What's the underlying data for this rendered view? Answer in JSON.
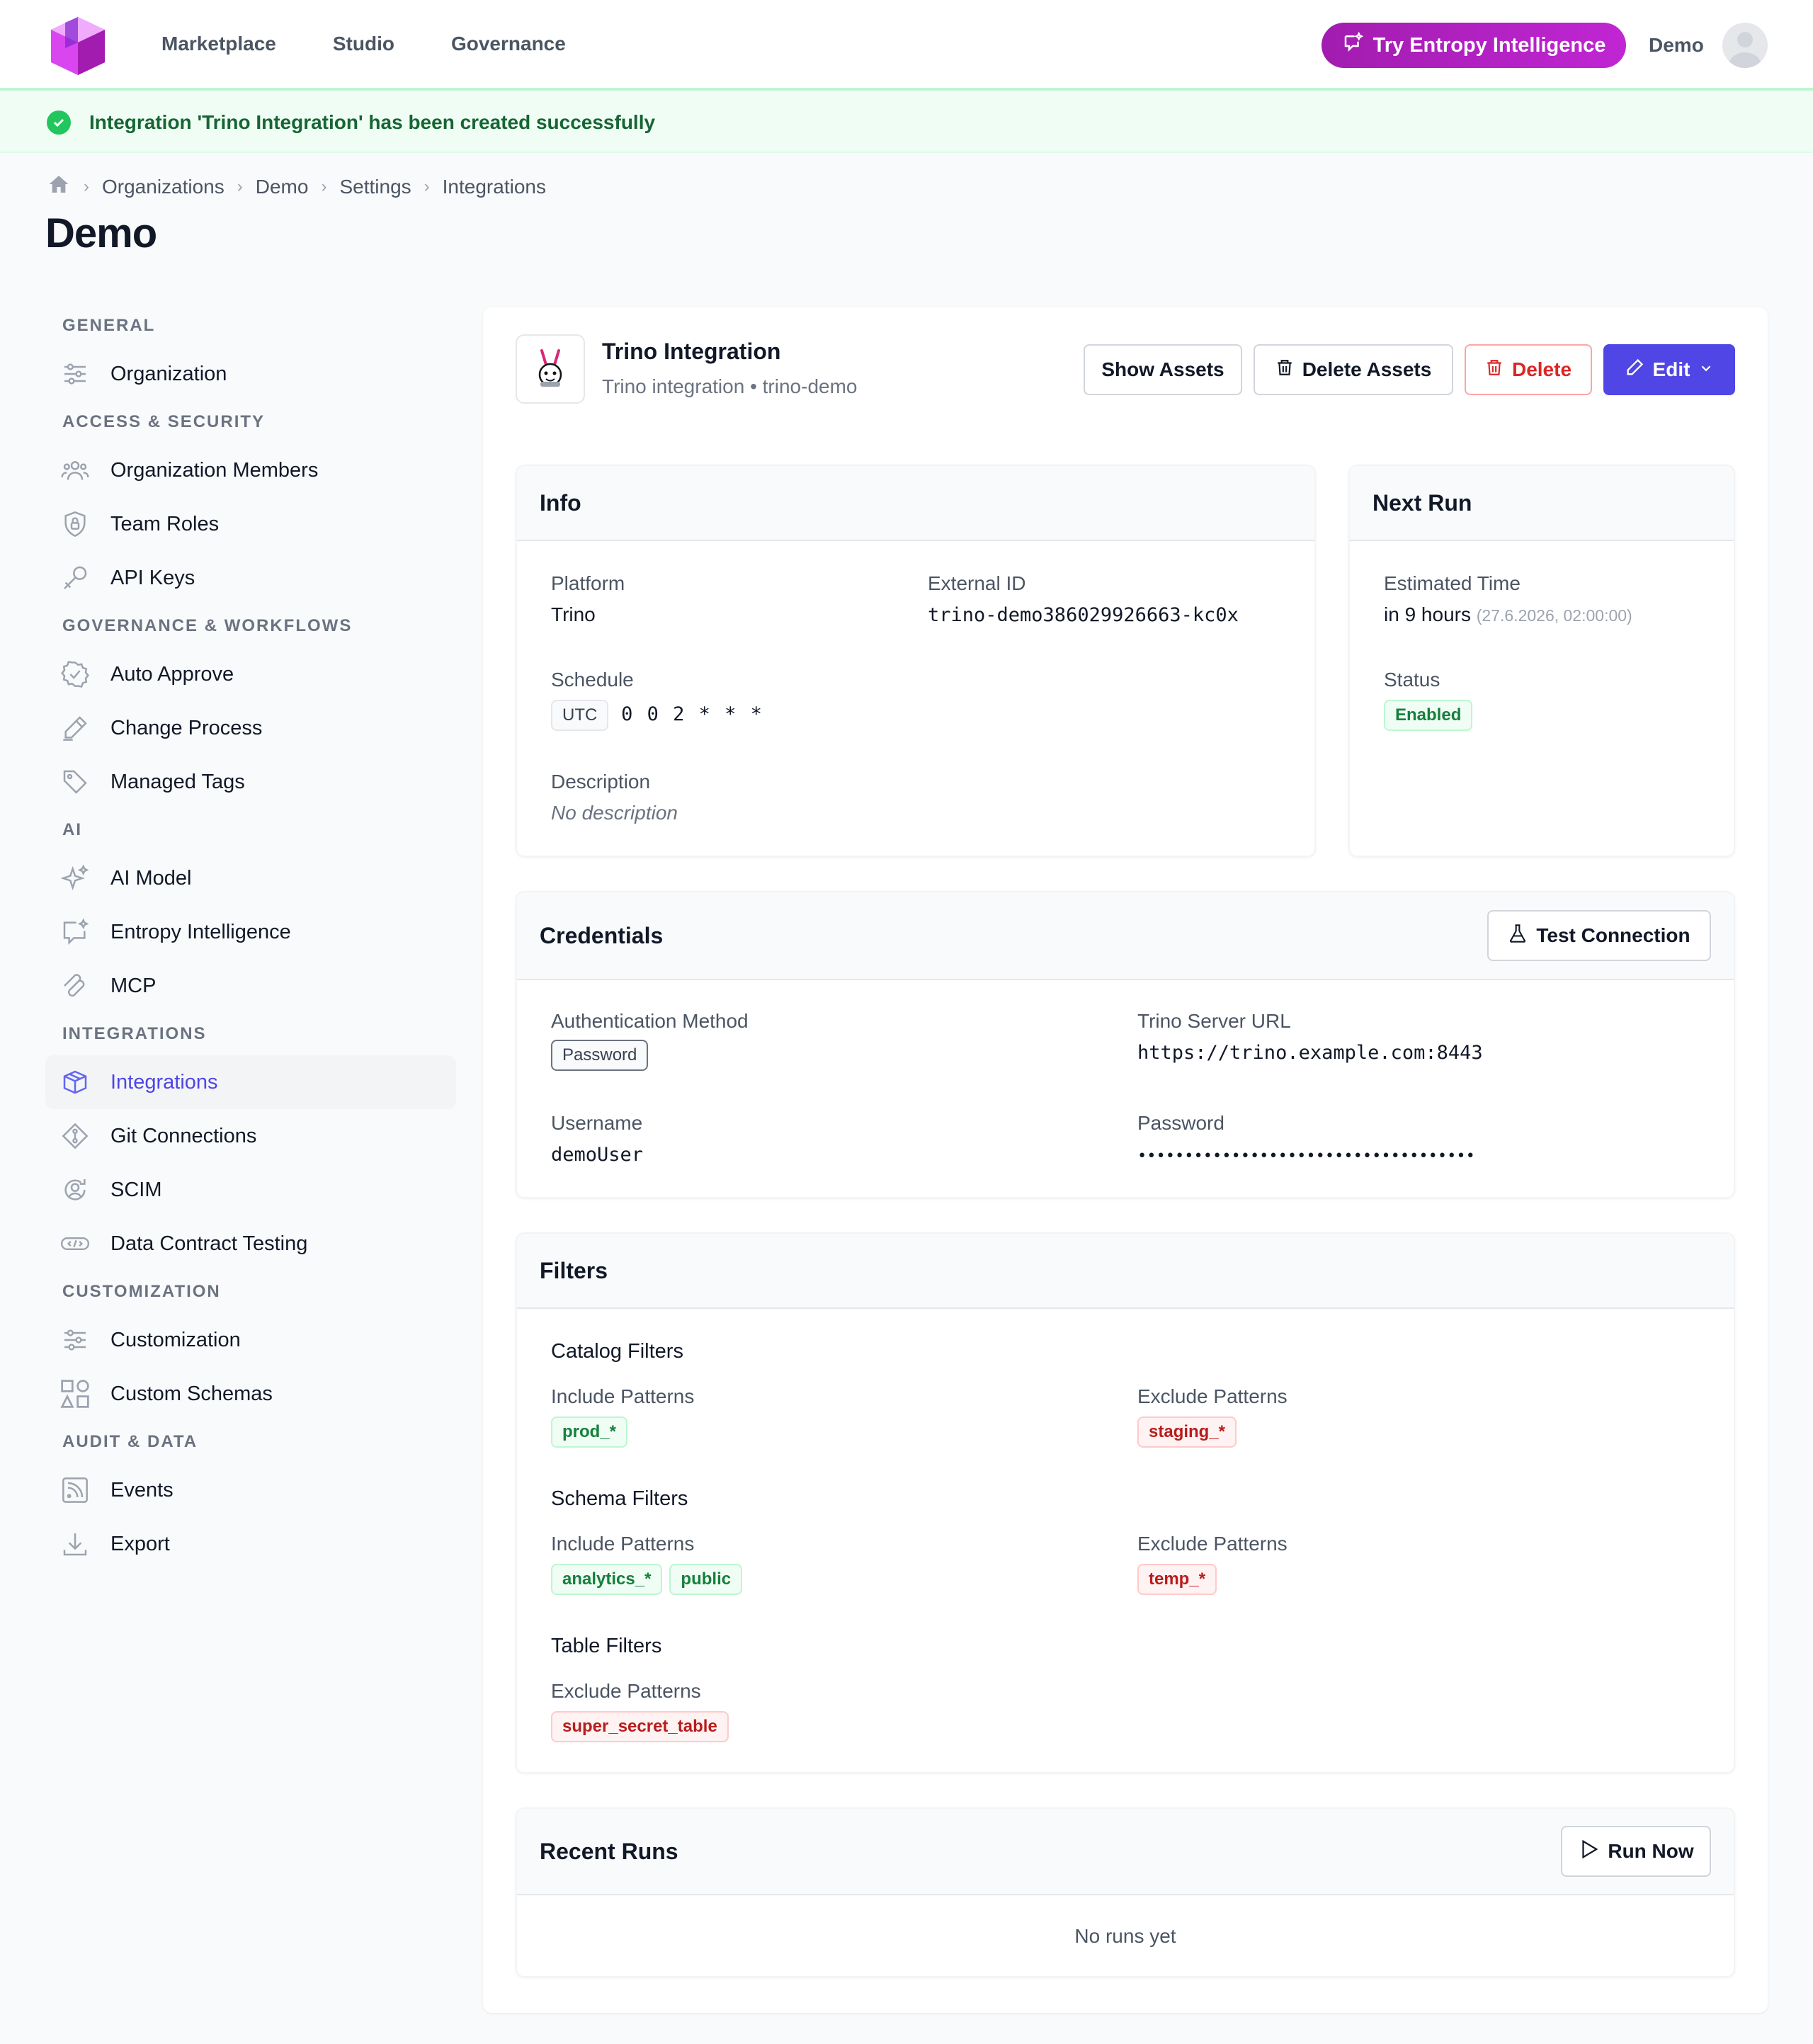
{
  "nav": {
    "items": [
      "Marketplace",
      "Studio",
      "Governance"
    ],
    "try_button": "Try Entropy Intelligence",
    "user": "Demo"
  },
  "banner": {
    "message": "Integration 'Trino Integration' has been created successfully"
  },
  "breadcrumb": [
    "Organizations",
    "Demo",
    "Settings",
    "Integrations"
  ],
  "page_title": "Demo",
  "sidebar": {
    "sections": [
      {
        "title": "GENERAL",
        "items": [
          "Organization"
        ]
      },
      {
        "title": "ACCESS & SECURITY",
        "items": [
          "Organization Members",
          "Team Roles",
          "API Keys"
        ]
      },
      {
        "title": "GOVERNANCE & WORKFLOWS",
        "items": [
          "Auto Approve",
          "Change Process",
          "Managed Tags"
        ]
      },
      {
        "title": "AI",
        "items": [
          "AI Model",
          "Entropy Intelligence",
          "MCP"
        ]
      },
      {
        "title": "INTEGRATIONS",
        "items": [
          "Integrations",
          "Git Connections",
          "SCIM",
          "Data Contract Testing"
        ]
      },
      {
        "title": "CUSTOMIZATION",
        "items": [
          "Customization",
          "Custom Schemas"
        ]
      },
      {
        "title": "AUDIT & DATA",
        "items": [
          "Events",
          "Export"
        ]
      }
    ],
    "active": "Integrations"
  },
  "integration": {
    "title": "Trino Integration",
    "subtitle": "Trino integration • trino-demo",
    "buttons": {
      "show_assets": "Show Assets",
      "delete_assets": "Delete Assets",
      "delete": "Delete",
      "edit": "Edit"
    }
  },
  "info": {
    "heading": "Info",
    "platform_label": "Platform",
    "platform": "Trino",
    "external_id_label": "External ID",
    "external_id": "trino-demo386029926663-kc0x",
    "schedule_label": "Schedule",
    "schedule_tz": "UTC",
    "schedule_cron": "0 0 2 * * *",
    "description_label": "Description",
    "description": "No description"
  },
  "next_run": {
    "heading": "Next Run",
    "estimated_label": "Estimated Time",
    "estimated": "in 9 hours",
    "estimated_exact": "(27.6.2026, 02:00:00)",
    "status_label": "Status",
    "status": "Enabled"
  },
  "credentials": {
    "heading": "Credentials",
    "test_button": "Test Connection",
    "auth_label": "Authentication Method",
    "auth": "Password",
    "url_label": "Trino Server URL",
    "url": "https://trino.example.com:8443",
    "username_label": "Username",
    "username": "demoUser",
    "password_label": "Password",
    "password": "••••••••••••••••••••••••••••••••••••"
  },
  "filters": {
    "heading": "Filters",
    "catalog": {
      "title": "Catalog Filters",
      "include_label": "Include Patterns",
      "include": [
        "prod_*"
      ],
      "exclude_label": "Exclude Patterns",
      "exclude": [
        "staging_*"
      ]
    },
    "schema": {
      "title": "Schema Filters",
      "include_label": "Include Patterns",
      "include": [
        "analytics_*",
        "public"
      ],
      "exclude_label": "Exclude Patterns",
      "exclude": [
        "temp_*"
      ]
    },
    "table": {
      "title": "Table Filters",
      "exclude_label": "Exclude Patterns",
      "exclude": [
        "super_secret_table"
      ]
    }
  },
  "recent_runs": {
    "heading": "Recent Runs",
    "run_button": "Run Now",
    "empty": "No runs yet"
  },
  "colors": {
    "accent": "#4f46e5",
    "success": "#22c55e",
    "danger": "#dc2626",
    "brand": "#c026d3"
  }
}
